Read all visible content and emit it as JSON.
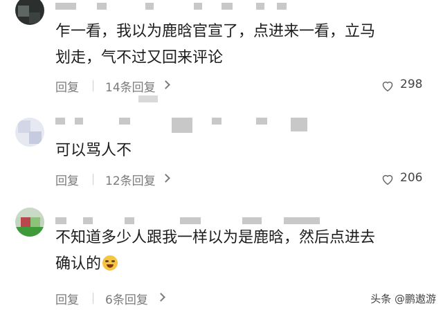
{
  "comments": [
    {
      "text_line1": "乍一看，我以为鹿晗官宣了，点进来一看，立马",
      "text_line2": "划走，气不过又回来评论",
      "reply_label": "回复",
      "replies_label": "14条回复",
      "likes": "298"
    },
    {
      "text_line1": "可以骂人不",
      "text_line2": "",
      "reply_label": "回复",
      "replies_label": "12条回复",
      "likes": "206"
    },
    {
      "text_line1": "不知道多少人跟我一样以为是鹿晗，然后点进去",
      "text_line2": "确认的",
      "reply_label": "回复",
      "replies_label": "6条回复",
      "likes": ""
    }
  ],
  "watermark": "头条 @鹏遨游",
  "colors": {
    "text": "#1d1d1d",
    "muted": "#7a7a7a",
    "background": "#ffffff"
  },
  "icons": [
    "avatar",
    "chevron-right-icon",
    "heart-icon",
    "laughing-crying-emoji-icon"
  ]
}
